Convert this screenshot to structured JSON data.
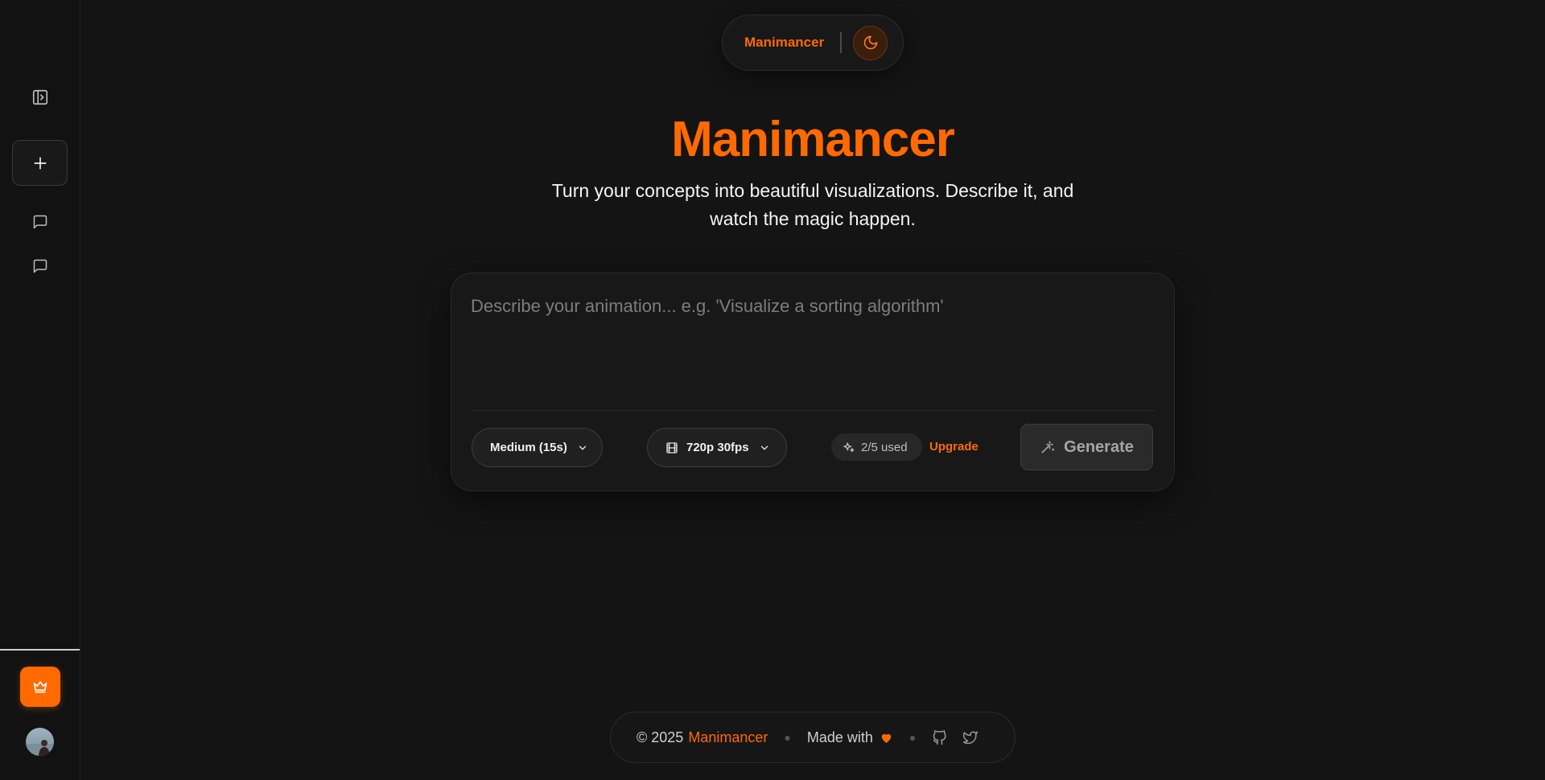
{
  "app": {
    "brand": "Manimancer",
    "accent": "#ff6a00",
    "background": "#141414"
  },
  "sidebar": {
    "items": [
      {
        "name": "toggle-sidebar",
        "icon": "panel-right-icon"
      },
      {
        "name": "new-chat",
        "icon": "plus-icon"
      },
      {
        "name": "chat-1",
        "icon": "message-square-icon"
      },
      {
        "name": "chat-2",
        "icon": "message-square-icon"
      }
    ],
    "bottom": [
      {
        "name": "upgrade",
        "icon": "crown-icon"
      },
      {
        "name": "profile",
        "icon": "avatar"
      }
    ]
  },
  "topbar": {
    "brand": "Manimancer",
    "theme_toggle_icon": "moon-icon"
  },
  "hero": {
    "title": "Manimancer",
    "subtitle": "Turn your concepts into beautiful visualizations. Describe it, and watch the magic happen."
  },
  "composer": {
    "value": "",
    "placeholder": "Describe your animation... e.g. 'Visualize a sorting algorithm'",
    "duration_label": "Medium (15s)",
    "resolution_label": "720p 30fps",
    "usage_label": "2/5 used",
    "upgrade_label": "Upgrade",
    "generate_label": "Generate"
  },
  "footer": {
    "copyright": "© 2025",
    "brand": "Manimancer",
    "made_with": "Made with",
    "links": [
      "github-icon",
      "twitter-icon"
    ]
  }
}
